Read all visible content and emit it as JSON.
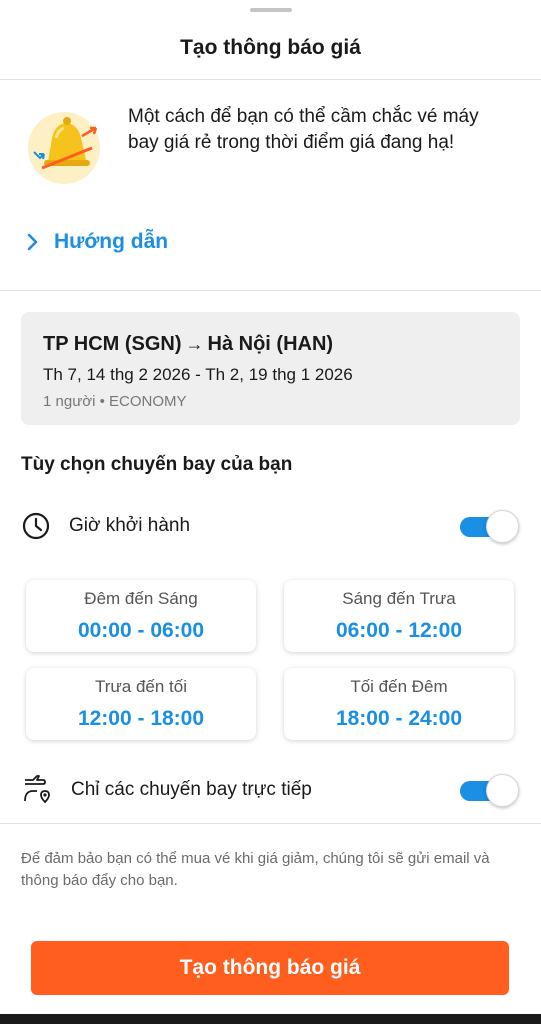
{
  "sheet": {
    "title": "Tạo thông báo giá"
  },
  "intro": {
    "text": "Một cách để bạn có thể cầm chắc vé máy bay giá rẻ trong thời điểm giá đang hạ!",
    "illustration": "bell-price-drop-illustration"
  },
  "guide": {
    "label": "Hướng dẫn",
    "icon": "chevron-right-icon"
  },
  "route": {
    "origin": "TP HCM (SGN)",
    "arrow": "→",
    "destination": "Hà Nội (HAN)",
    "dates": "Th 7, 14 thg 2 2026 - Th 2, 19 thg 1 2026",
    "passengers": "1 người • ECONOMY"
  },
  "options": {
    "section_title": "Tùy chọn chuyến bay của bạn",
    "departure_time": {
      "label": "Giờ khởi hành",
      "icon": "clock-icon",
      "enabled": true
    },
    "slots": [
      {
        "label": "Đêm đến Sáng",
        "time": "00:00 - 06:00"
      },
      {
        "label": "Sáng đến Trưa",
        "time": "06:00 - 12:00"
      },
      {
        "label": "Trưa đến tối",
        "time": "12:00 - 18:00"
      },
      {
        "label": "Tối đến Đêm",
        "time": "18:00 - 24:00"
      }
    ],
    "direct_only": {
      "label": "Chỉ các chuyến bay trực tiếp",
      "icon": "plane-route-icon",
      "enabled": true
    }
  },
  "note": {
    "text": "Để đảm bảo bạn có thể mua vé khi giá giảm, chúng tôi sẽ gửi email và thông báo đẩy cho bạn."
  },
  "cta": {
    "label": "Tạo thông báo giá"
  },
  "colors": {
    "accent": "#1a8fe3",
    "cta": "#ff5e1f",
    "card_bg": "#efefef"
  }
}
